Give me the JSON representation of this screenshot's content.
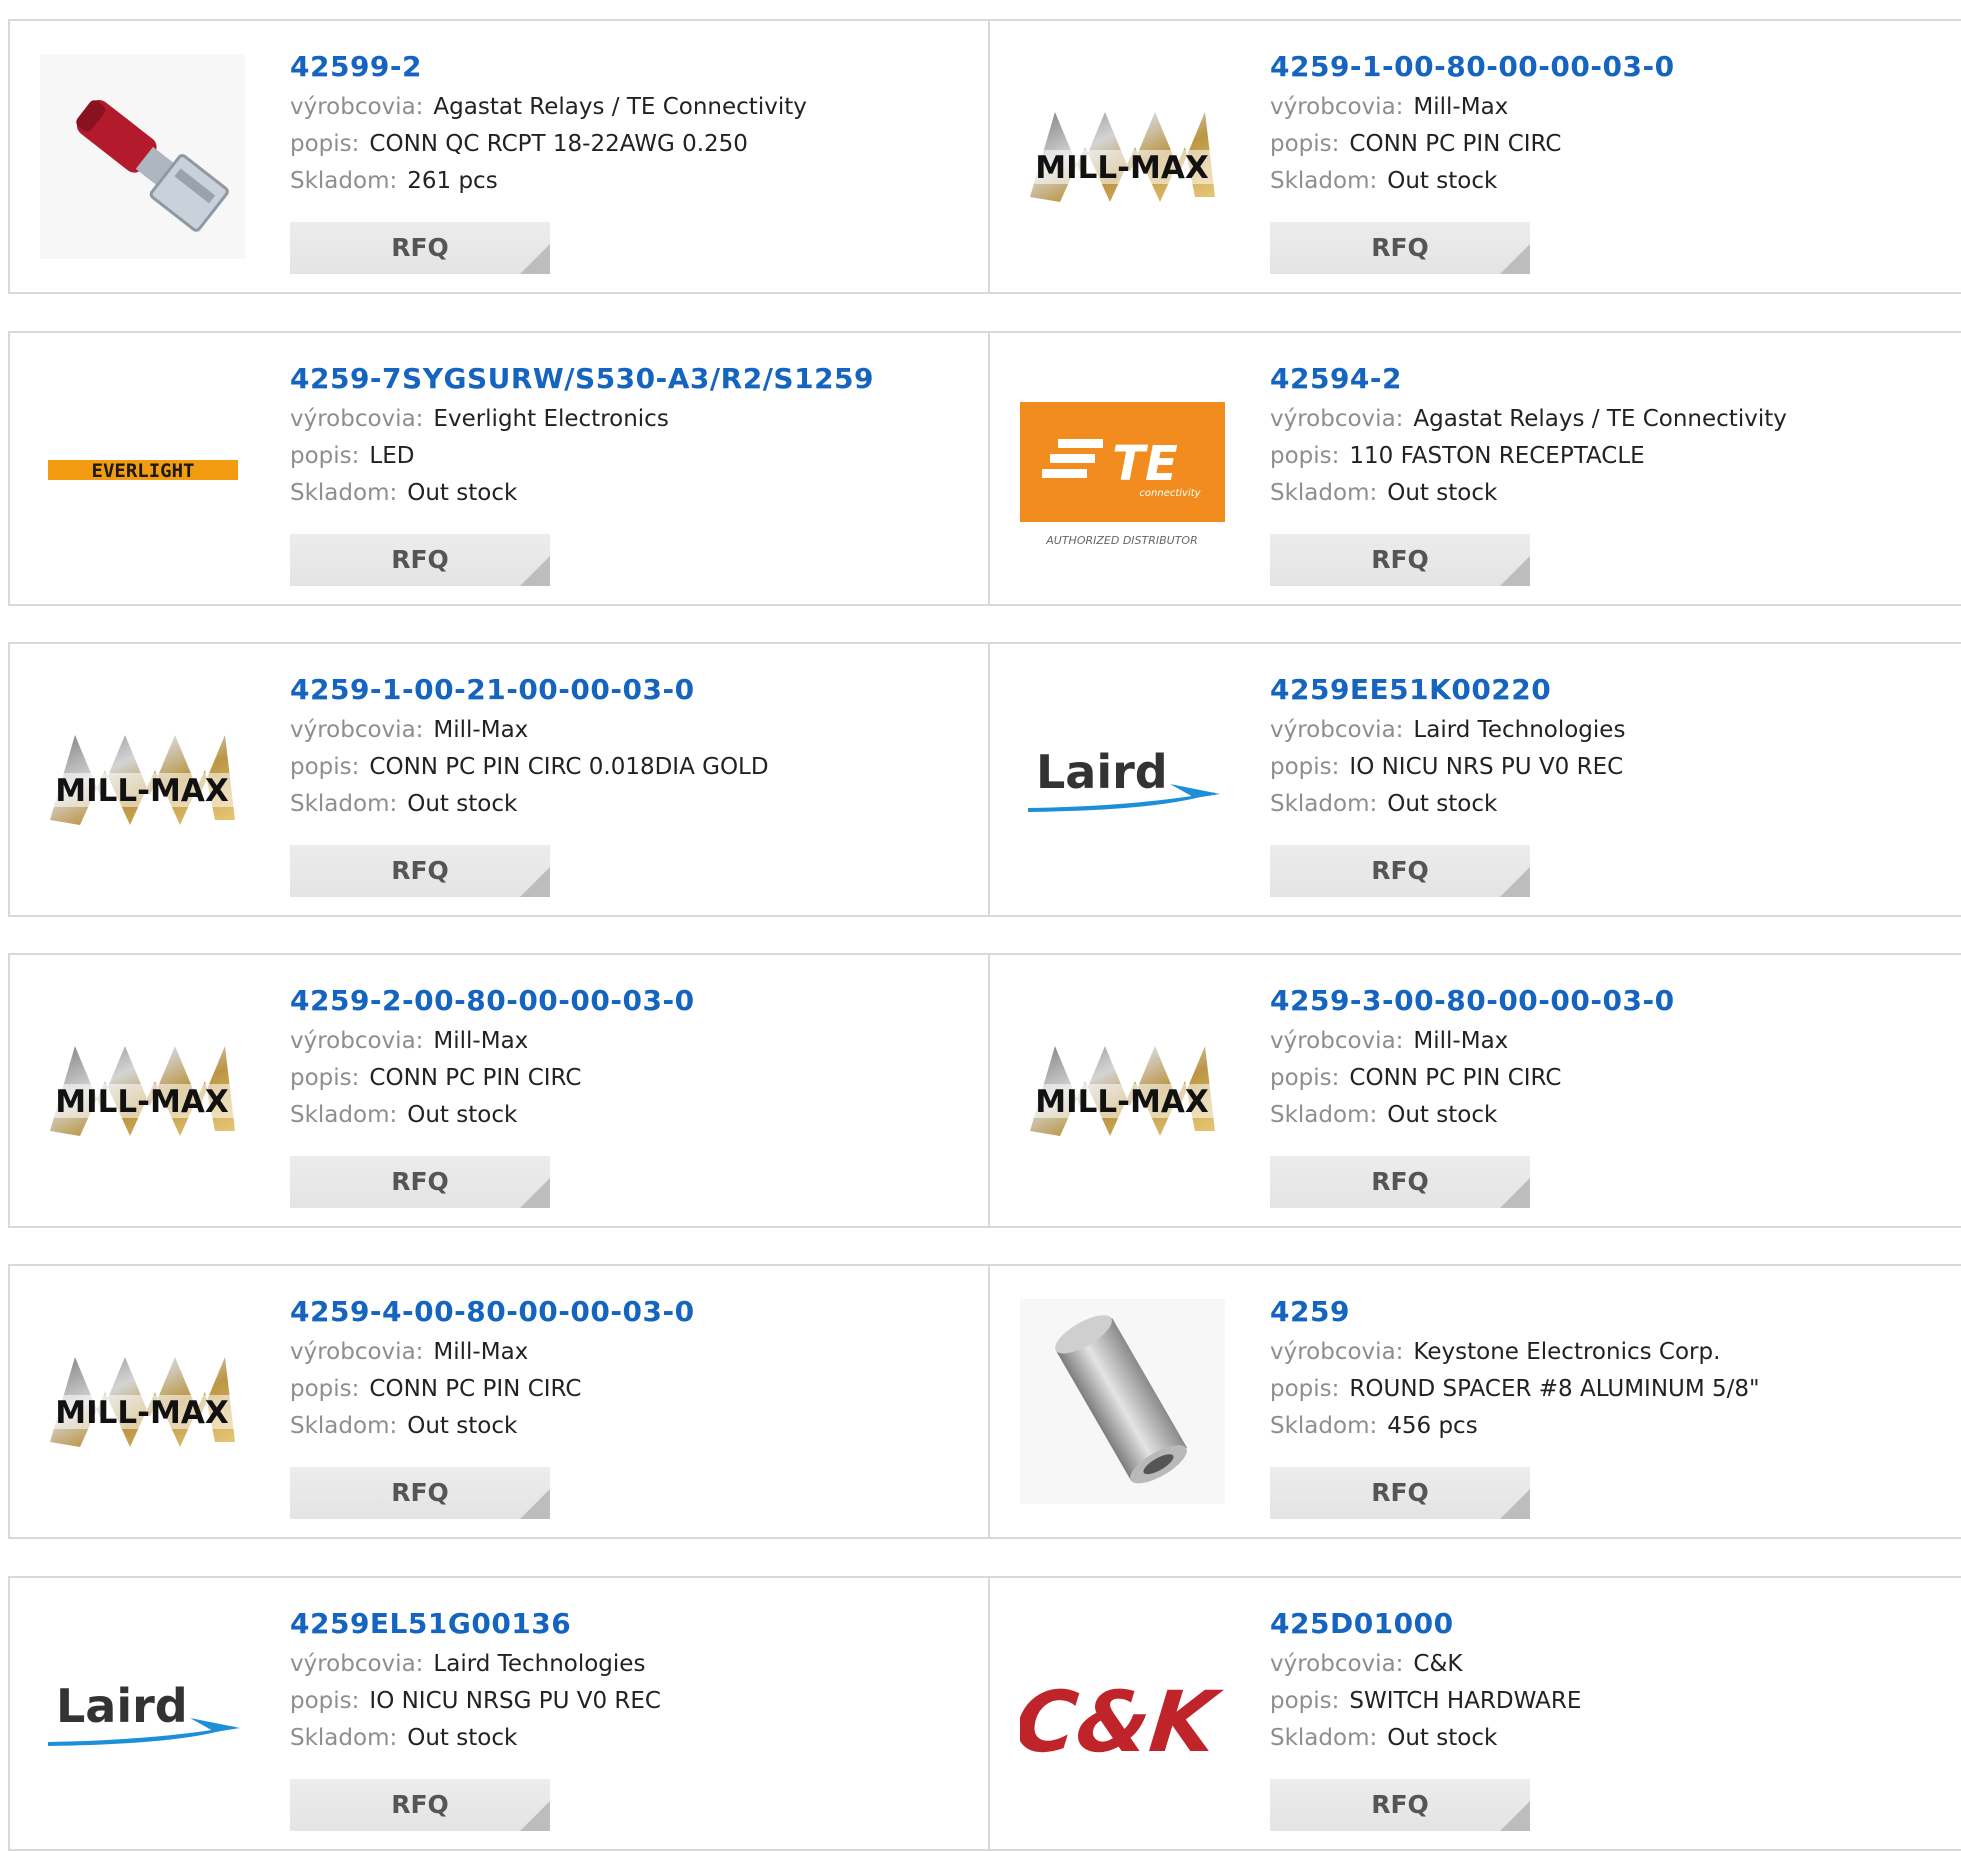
{
  "labels": {
    "manufacturer": "výrobcovia:",
    "description": "popis:",
    "stock": "Skladom:",
    "rfq": "RFQ"
  },
  "logo_texts": {
    "millmax": "MILL-MAX",
    "everlight": "EVERLIGHT",
    "te": "TE",
    "te_sub": "connectivity",
    "te_caption": "AUTHORIZED DISTRIBUTOR",
    "laird": "Laird",
    "ck": "C&K"
  },
  "products": [
    {
      "part": "42599-2",
      "manufacturer": "Agastat Relays / TE Connectivity",
      "description": "CONN QC RCPT 18-22AWG 0.250",
      "stock": "261 pcs",
      "logo": "red-connector-photo"
    },
    {
      "part": "4259-1-00-80-00-00-03-0",
      "manufacturer": "Mill-Max",
      "description": "CONN PC PIN CIRC",
      "stock": "Out stock",
      "logo": "millmax"
    },
    {
      "part": "4259-7SYGSURW/S530-A3/R2/S1259",
      "manufacturer": "Everlight Electronics",
      "description": "LED",
      "stock": "Out stock",
      "logo": "everlight"
    },
    {
      "part": "42594-2",
      "manufacturer": "Agastat Relays / TE Connectivity",
      "description": "110 FASTON RECEPTACLE",
      "stock": "Out stock",
      "logo": "te"
    },
    {
      "part": "4259-1-00-21-00-00-03-0",
      "manufacturer": "Mill-Max",
      "description": "CONN PC PIN CIRC 0.018DIA GOLD",
      "stock": "Out stock",
      "logo": "millmax"
    },
    {
      "part": "4259EE51K00220",
      "manufacturer": "Laird Technologies",
      "description": "IO NICU NRS PU V0 REC",
      "stock": "Out stock",
      "logo": "laird"
    },
    {
      "part": "4259-2-00-80-00-00-03-0",
      "manufacturer": "Mill-Max",
      "description": "CONN PC PIN CIRC",
      "stock": "Out stock",
      "logo": "millmax"
    },
    {
      "part": "4259-3-00-80-00-00-03-0",
      "manufacturer": "Mill-Max",
      "description": "CONN PC PIN CIRC",
      "stock": "Out stock",
      "logo": "millmax"
    },
    {
      "part": "4259-4-00-80-00-00-03-0",
      "manufacturer": "Mill-Max",
      "description": "CONN PC PIN CIRC",
      "stock": "Out stock",
      "logo": "millmax"
    },
    {
      "part": "4259",
      "manufacturer": "Keystone Electronics Corp.",
      "description": "ROUND SPACER #8 ALUMINUM 5/8\"",
      "stock": "456 pcs",
      "logo": "spacer-photo"
    },
    {
      "part": "4259EL51G00136",
      "manufacturer": "Laird Technologies",
      "description": "IO NICU NRSG PU V0 REC",
      "stock": "Out stock",
      "logo": "laird"
    },
    {
      "part": "425D01000",
      "manufacturer": "C&K",
      "description": "SWITCH HARDWARE",
      "stock": "Out stock",
      "logo": "ck"
    }
  ],
  "colors": {
    "link": "#1565c0",
    "label": "#8e8e8e",
    "border": "#d9d9d9",
    "te_orange": "#f28c1e",
    "ck_red": "#c0242b",
    "laird_blue": "#1d8fd8"
  }
}
